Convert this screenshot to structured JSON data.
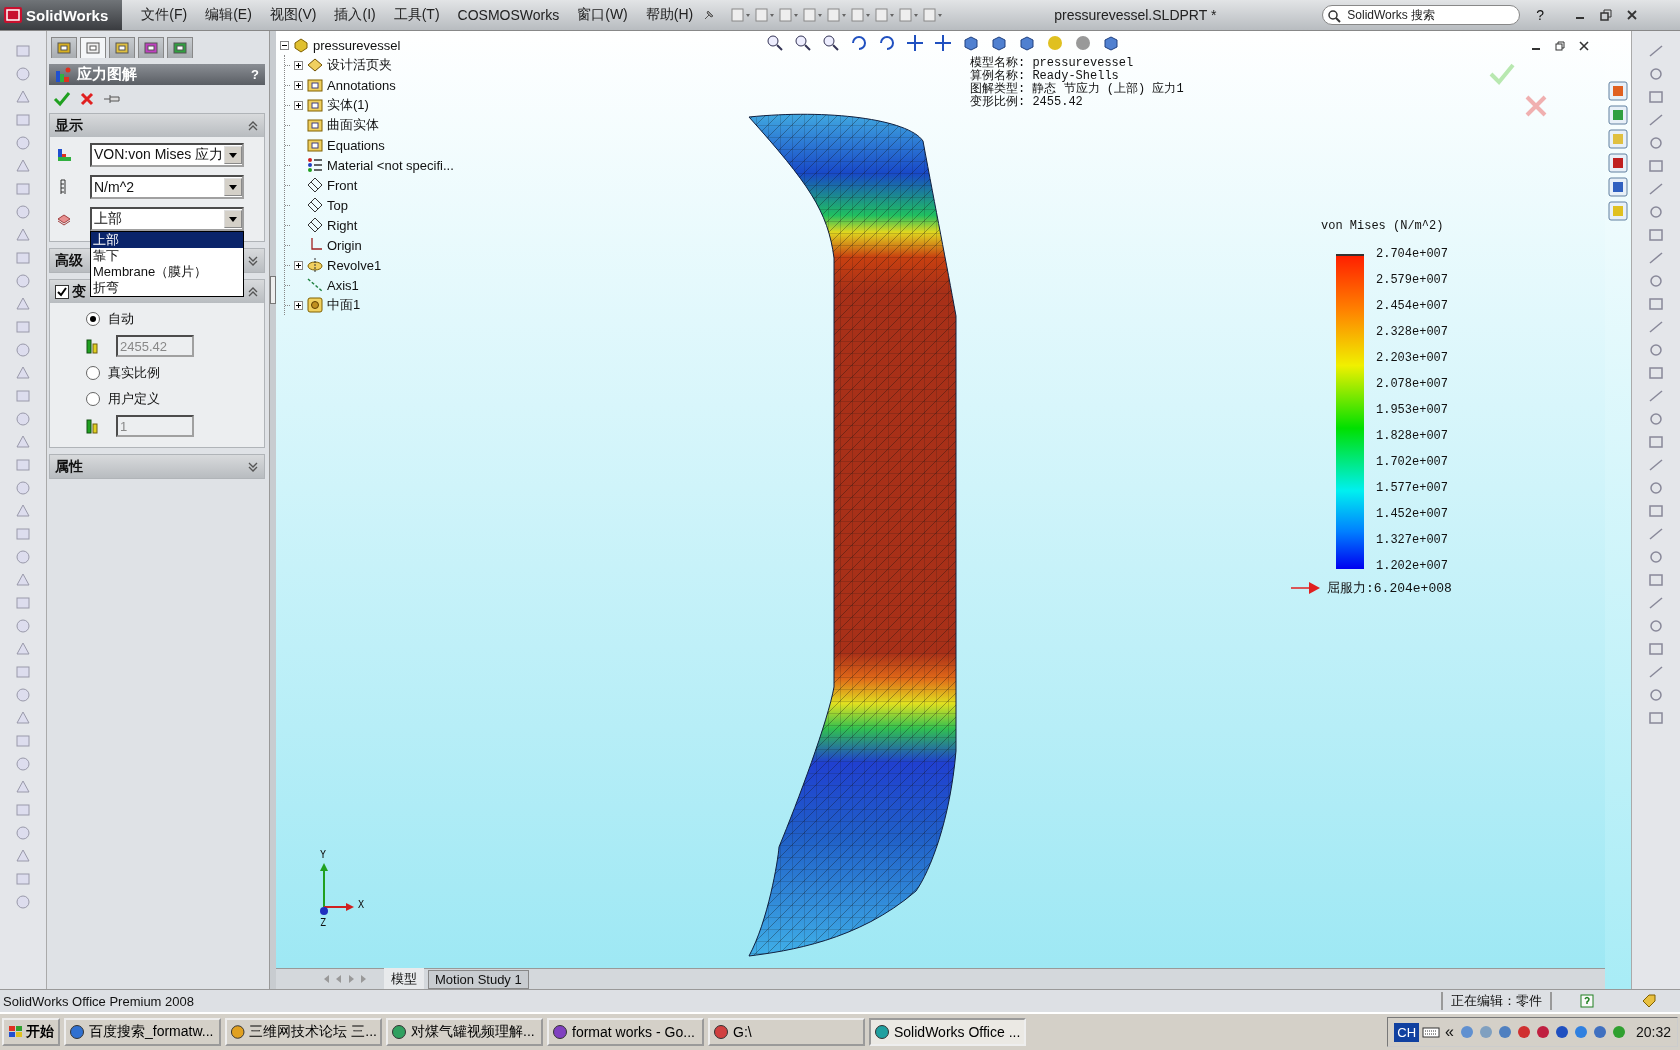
{
  "menubar": {
    "logo": "SolidWorks",
    "menus": [
      "文件(F)",
      "编辑(E)",
      "视图(V)",
      "插入(I)",
      "工具(T)",
      "COSMOSWorks",
      "窗口(W)",
      "帮助(H)"
    ],
    "document_title": "pressurevessel.SLDPRT *",
    "search": {
      "placeholder": "SolidWorks 搜索"
    },
    "help": "?"
  },
  "property_manager": {
    "tabs": [
      {
        "selected": false
      },
      {
        "selected": true
      },
      {
        "selected": false
      },
      {
        "selected": false
      },
      {
        "selected": false
      }
    ],
    "title": "应力图解",
    "help": "?",
    "display_group": {
      "title": "显示",
      "expanded": true,
      "fields": [
        {
          "value": "VON:von Mises 应力",
          "open": false
        },
        {
          "value": "N/m^2",
          "open": false
        },
        {
          "value": "上部",
          "open": true,
          "options": [
            {
              "label": "上部",
              "selected": true
            },
            {
              "label": "靠下",
              "selected": false
            },
            {
              "label": "Membrane（膜片）",
              "selected": false
            },
            {
              "label": "折弯",
              "selected": false
            }
          ]
        }
      ]
    },
    "advanced_group": {
      "title": "高级",
      "expanded": false
    },
    "deform_group": {
      "title": "变",
      "checked": true,
      "expanded": true,
      "items": [
        {
          "kind": "radio",
          "label": "自动",
          "selected": true
        },
        {
          "kind": "field",
          "value": "2455.42",
          "disabled": true
        },
        {
          "kind": "radio",
          "label": "真实比例",
          "selected": false
        },
        {
          "kind": "radio",
          "label": "用户定义",
          "selected": false
        },
        {
          "kind": "field",
          "value": "1",
          "disabled": true
        }
      ]
    },
    "properties_group": {
      "title": "属性",
      "expanded": false
    }
  },
  "feature_tree": {
    "label": "pressurevessel",
    "kind": "part",
    "expanded": true,
    "children": [
      {
        "label": "设计活页夹",
        "kind": "binder",
        "expandable": true,
        "expanded": false
      },
      {
        "label": "Annotations",
        "kind": "folder",
        "expandable": true,
        "expanded": false
      },
      {
        "label": "实体(1)",
        "kind": "folder",
        "expandable": true,
        "expanded": false
      },
      {
        "label": "曲面实体",
        "kind": "folder",
        "expandable": false
      },
      {
        "label": "Equations",
        "kind": "folder",
        "expandable": false
      },
      {
        "label": "Material <not specifi...",
        "kind": "material",
        "expandable": false
      },
      {
        "label": "Front",
        "kind": "plane",
        "expandable": false
      },
      {
        "label": "Top",
        "kind": "plane",
        "expandable": false
      },
      {
        "label": "Right",
        "kind": "plane",
        "expandable": false
      },
      {
        "label": "Origin",
        "kind": "origin",
        "expandable": false
      },
      {
        "label": "Revolve1",
        "kind": "feature",
        "expandable": true,
        "expanded": false
      },
      {
        "label": "Axis1",
        "kind": "axis",
        "expandable": false
      },
      {
        "label": "中面1",
        "kind": "midsurface",
        "expandable": true,
        "expanded": false
      }
    ]
  },
  "viewport": {
    "info_lines": [
      "模型名称: pressurevessel",
      "算例名称: Ready-Shells",
      "图解类型: 静态 节应力 (上部) 应力1",
      "变形比例: 2455.42"
    ],
    "legend": {
      "title": "von Mises (N/m^2)",
      "labels": [
        "2.704e+007",
        "2.579e+007",
        "2.454e+007",
        "2.328e+007",
        "2.203e+007",
        "2.078e+007",
        "1.953e+007",
        "1.828e+007",
        "1.702e+007",
        "1.577e+007",
        "1.452e+007",
        "1.327e+007",
        "1.202e+007"
      ],
      "yield_label": "屈服力:6.204e+008"
    },
    "axes": [
      "X",
      "Y",
      "Z"
    ]
  },
  "bottom_tabs": [
    {
      "label": "模型",
      "selected": true
    },
    {
      "label": "Motion Study 1",
      "selected": false
    }
  ],
  "status_bar": {
    "product": "SolidWorks Office Premium 2008",
    "editing": "正在编辑：零件"
  },
  "taskbar": {
    "start": "开始",
    "tasks": [
      {
        "label": "百度搜索_formatw...",
        "selected": false
      },
      {
        "label": "三维网技术论坛 三...",
        "selected": false
      },
      {
        "label": "对煤气罐视频理解...",
        "selected": false
      },
      {
        "label": "format works - Go...",
        "selected": false
      },
      {
        "label": "G:\\",
        "selected": false
      },
      {
        "label": "SolidWorks Office ...",
        "selected": true
      }
    ],
    "language": "CH",
    "tray_chevron": "«",
    "clock": "20:32"
  }
}
